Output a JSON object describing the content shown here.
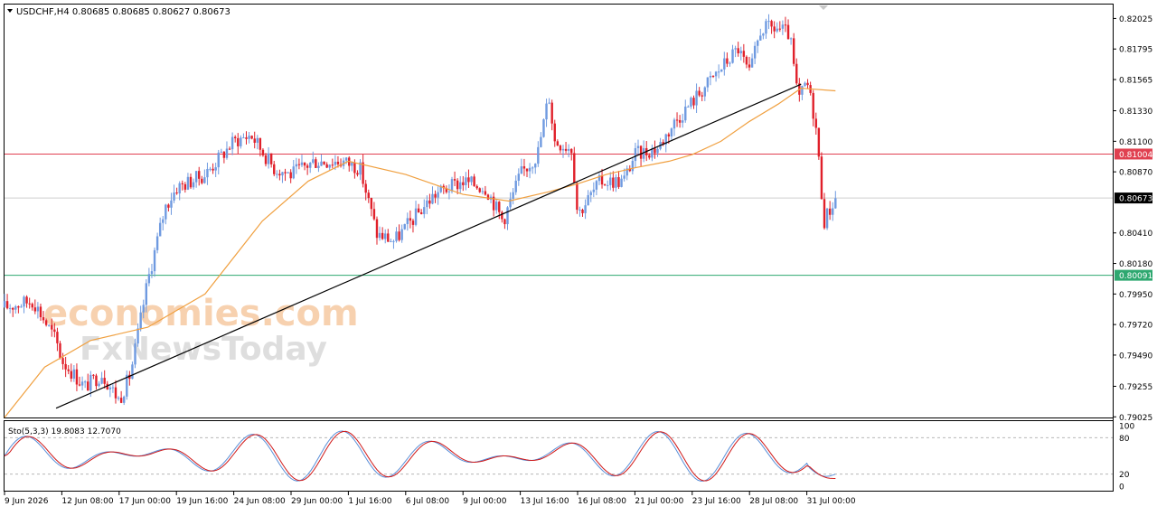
{
  "colors": {
    "bull": "#6f9ae0",
    "bear": "#e0202a",
    "ma": "#f0a040",
    "trendline": "#000000",
    "resistance": "#e04050",
    "support": "#2ea870",
    "current": "#cfcfcf",
    "stoch_k": "#5a8fd8",
    "stoch_d": "#d01818",
    "grid_dash": "#b8b8b8",
    "watermark_orange": "#f6c9a2",
    "watermark_gray": "#d4d4d4"
  },
  "header": {
    "title": "USDCHF,H4  0.80685 0.80685 0.80627 0.80673"
  },
  "watermark": {
    "line1": "economies.com",
    "line2": "FxNewsToday"
  },
  "main_chart": {
    "ylim": [
      0.7902,
      0.8213
    ],
    "y_ticks": [
      "0.82025",
      "0.81795",
      "0.81565",
      "0.81330",
      "0.81100",
      "0.80870",
      "0.80410",
      "0.80180",
      "0.79950",
      "0.79720",
      "0.79490",
      "0.79255",
      "0.79025"
    ],
    "price_labels": {
      "resistance": {
        "value": 0.81004,
        "text": "0.81004"
      },
      "current": {
        "value": 0.80673,
        "text": "0.80673"
      },
      "support": {
        "value": 0.80091,
        "text": "0.80091"
      }
    },
    "trendline": {
      "x_start": 0.9,
      "y_start": 0.7909,
      "x_end": 13.9,
      "y_end": 0.8153
    }
  },
  "stochastic": {
    "label": "Sto(5,3,3) 19.8083 12.7070",
    "k_value": 19.8083,
    "d_value": 12.707,
    "levels": [
      "100",
      "80",
      "20",
      "0"
    ]
  },
  "x_axis": {
    "labels": [
      "9 Jun 2026",
      "12 Jun 08:00",
      "17 Jun 00:00",
      "19 Jun 16:00",
      "24 Jun 08:00",
      "29 Jun 00:00",
      "1 Jul 16:00",
      "6 Jul 08:00",
      "9 Jul 00:00",
      "13 Jul 16:00",
      "16 Jul 08:00",
      "21 Jul 00:00",
      "23 Jul 16:00",
      "28 Jul 08:00",
      "31 Jul 00:00"
    ]
  },
  "chart_data": {
    "type": "candlestick",
    "symbol": "USDCHF",
    "timeframe": "H4",
    "title": "USDCHF,H4",
    "x_labels": [
      "9 Jun 2026",
      "12 Jun 08:00",
      "17 Jun 00:00",
      "19 Jun 16:00",
      "24 Jun 08:00",
      "29 Jun 00:00",
      "1 Jul 16:00",
      "6 Jul 08:00",
      "9 Jul 00:00",
      "13 Jul 16:00",
      "16 Jul 08:00",
      "21 Jul 00:00",
      "23 Jul 16:00",
      "28 Jul 08:00",
      "31 Jul 00:00"
    ],
    "last_ohlc": {
      "open": 0.80685,
      "high": 0.80685,
      "low": 0.80627,
      "close": 0.80673
    },
    "close_path": [
      [
        0.0,
        0.7985
      ],
      [
        0.5,
        0.799
      ],
      [
        0.9,
        0.796
      ],
      [
        1.0,
        0.7945
      ],
      [
        1.4,
        0.7925
      ],
      [
        1.7,
        0.7935
      ],
      [
        2.0,
        0.7915
      ],
      [
        2.2,
        0.7935
      ],
      [
        2.5,
        0.8005
      ],
      [
        2.8,
        0.806
      ],
      [
        3.0,
        0.8075
      ],
      [
        3.5,
        0.8085
      ],
      [
        4.0,
        0.811
      ],
      [
        4.3,
        0.8115
      ],
      [
        4.7,
        0.809
      ],
      [
        5.0,
        0.8085
      ],
      [
        5.4,
        0.8095
      ],
      [
        5.9,
        0.8095
      ],
      [
        6.2,
        0.809
      ],
      [
        6.5,
        0.804
      ],
      [
        6.8,
        0.8035
      ],
      [
        7.1,
        0.805
      ],
      [
        7.5,
        0.807
      ],
      [
        8.0,
        0.808
      ],
      [
        8.4,
        0.8075
      ],
      [
        8.7,
        0.805
      ],
      [
        9.0,
        0.8085
      ],
      [
        9.3,
        0.81
      ],
      [
        9.5,
        0.8145
      ],
      [
        9.6,
        0.811
      ],
      [
        9.9,
        0.8105
      ],
      [
        10.0,
        0.8055
      ],
      [
        10.4,
        0.808
      ],
      [
        10.8,
        0.808
      ],
      [
        11.0,
        0.81
      ],
      [
        11.4,
        0.8105
      ],
      [
        11.7,
        0.8125
      ],
      [
        12.0,
        0.814
      ],
      [
        12.4,
        0.816
      ],
      [
        12.8,
        0.818
      ],
      [
        13.0,
        0.816
      ],
      [
        13.2,
        0.8195
      ],
      [
        13.5,
        0.8195
      ],
      [
        13.7,
        0.819
      ],
      [
        13.85,
        0.814
      ],
      [
        14.0,
        0.8155
      ],
      [
        14.15,
        0.8125
      ],
      [
        14.3,
        0.805
      ],
      [
        14.5,
        0.8067
      ]
    ],
    "moving_average": [
      [
        0.0,
        0.7902
      ],
      [
        0.7,
        0.794
      ],
      [
        1.5,
        0.796
      ],
      [
        2.5,
        0.797
      ],
      [
        3.5,
        0.7995
      ],
      [
        4.5,
        0.805
      ],
      [
        5.3,
        0.808
      ],
      [
        6.0,
        0.8095
      ],
      [
        7.0,
        0.8085
      ],
      [
        8.0,
        0.807
      ],
      [
        8.8,
        0.8065
      ],
      [
        9.5,
        0.8072
      ],
      [
        10.0,
        0.8078
      ],
      [
        10.5,
        0.8085
      ],
      [
        11.0,
        0.809
      ],
      [
        11.6,
        0.8095
      ],
      [
        12.0,
        0.81
      ],
      [
        12.5,
        0.811
      ],
      [
        13.0,
        0.8125
      ],
      [
        13.5,
        0.8138
      ],
      [
        13.9,
        0.815
      ],
      [
        14.5,
        0.8148
      ]
    ],
    "stoch_ylim": [
      0,
      100
    ],
    "stoch_k_last": 19.8083,
    "stoch_d_last": 12.707,
    "horizontal_levels": [
      0.81004,
      0.80091
    ],
    "current_price": 0.80673
  }
}
